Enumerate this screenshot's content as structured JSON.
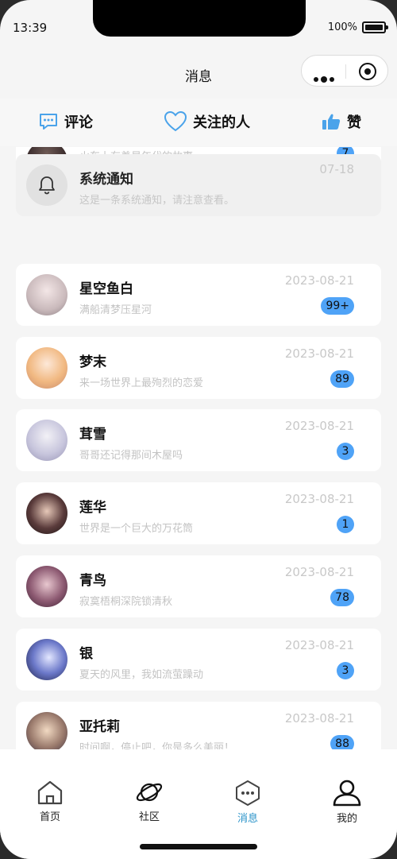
{
  "status": {
    "time": "13:39",
    "battery": "100%"
  },
  "nav": {
    "title": "消息"
  },
  "tabs": [
    {
      "label": "评论",
      "icon": "comment-icon"
    },
    {
      "label": "关注的人",
      "icon": "heart-icon"
    },
    {
      "label": "赞",
      "icon": "thumbs-up-icon"
    }
  ],
  "system": {
    "title": "系统通知",
    "message": "这是一条系统通知，请注意查看。",
    "date": "07-18"
  },
  "chats": [
    {
      "name": "",
      "message": "火车上有着最年代的故事",
      "date": "",
      "badge": "7"
    },
    {
      "name": "星空鱼白",
      "message": "满船清梦压星河",
      "date": "2023-08-21",
      "badge": "99+"
    },
    {
      "name": "梦末",
      "message": "来一场世界上最殉烈的恋爱",
      "date": "2023-08-21",
      "badge": "89"
    },
    {
      "name": "茸雪",
      "message": "哥哥还记得那间木屋吗",
      "date": "2023-08-21",
      "badge": "3"
    },
    {
      "name": "莲华",
      "message": "世界是一个巨大的万花筒",
      "date": "2023-08-21",
      "badge": "1"
    },
    {
      "name": "青鸟",
      "message": "寂寞梧桐深院锁清秋",
      "date": "2023-08-21",
      "badge": "78"
    },
    {
      "name": "银",
      "message": "夏天的风里，我如流萤躁动",
      "date": "2023-08-21",
      "badge": "3"
    },
    {
      "name": "亚托莉",
      "message": "时间啊，停止吧，你是多么美丽！",
      "date": "2023-08-21",
      "badge": "88"
    }
  ],
  "tabbar": [
    {
      "label": "首页",
      "icon": "home-icon"
    },
    {
      "label": "社区",
      "icon": "planet-icon"
    },
    {
      "label": "消息",
      "icon": "message-hexagon-icon"
    },
    {
      "label": "我的",
      "icon": "user-icon"
    }
  ],
  "colors": {
    "accent": "#2a93c9",
    "badge": "#4fa3f7",
    "tab_icon": "#4aa3ea"
  }
}
